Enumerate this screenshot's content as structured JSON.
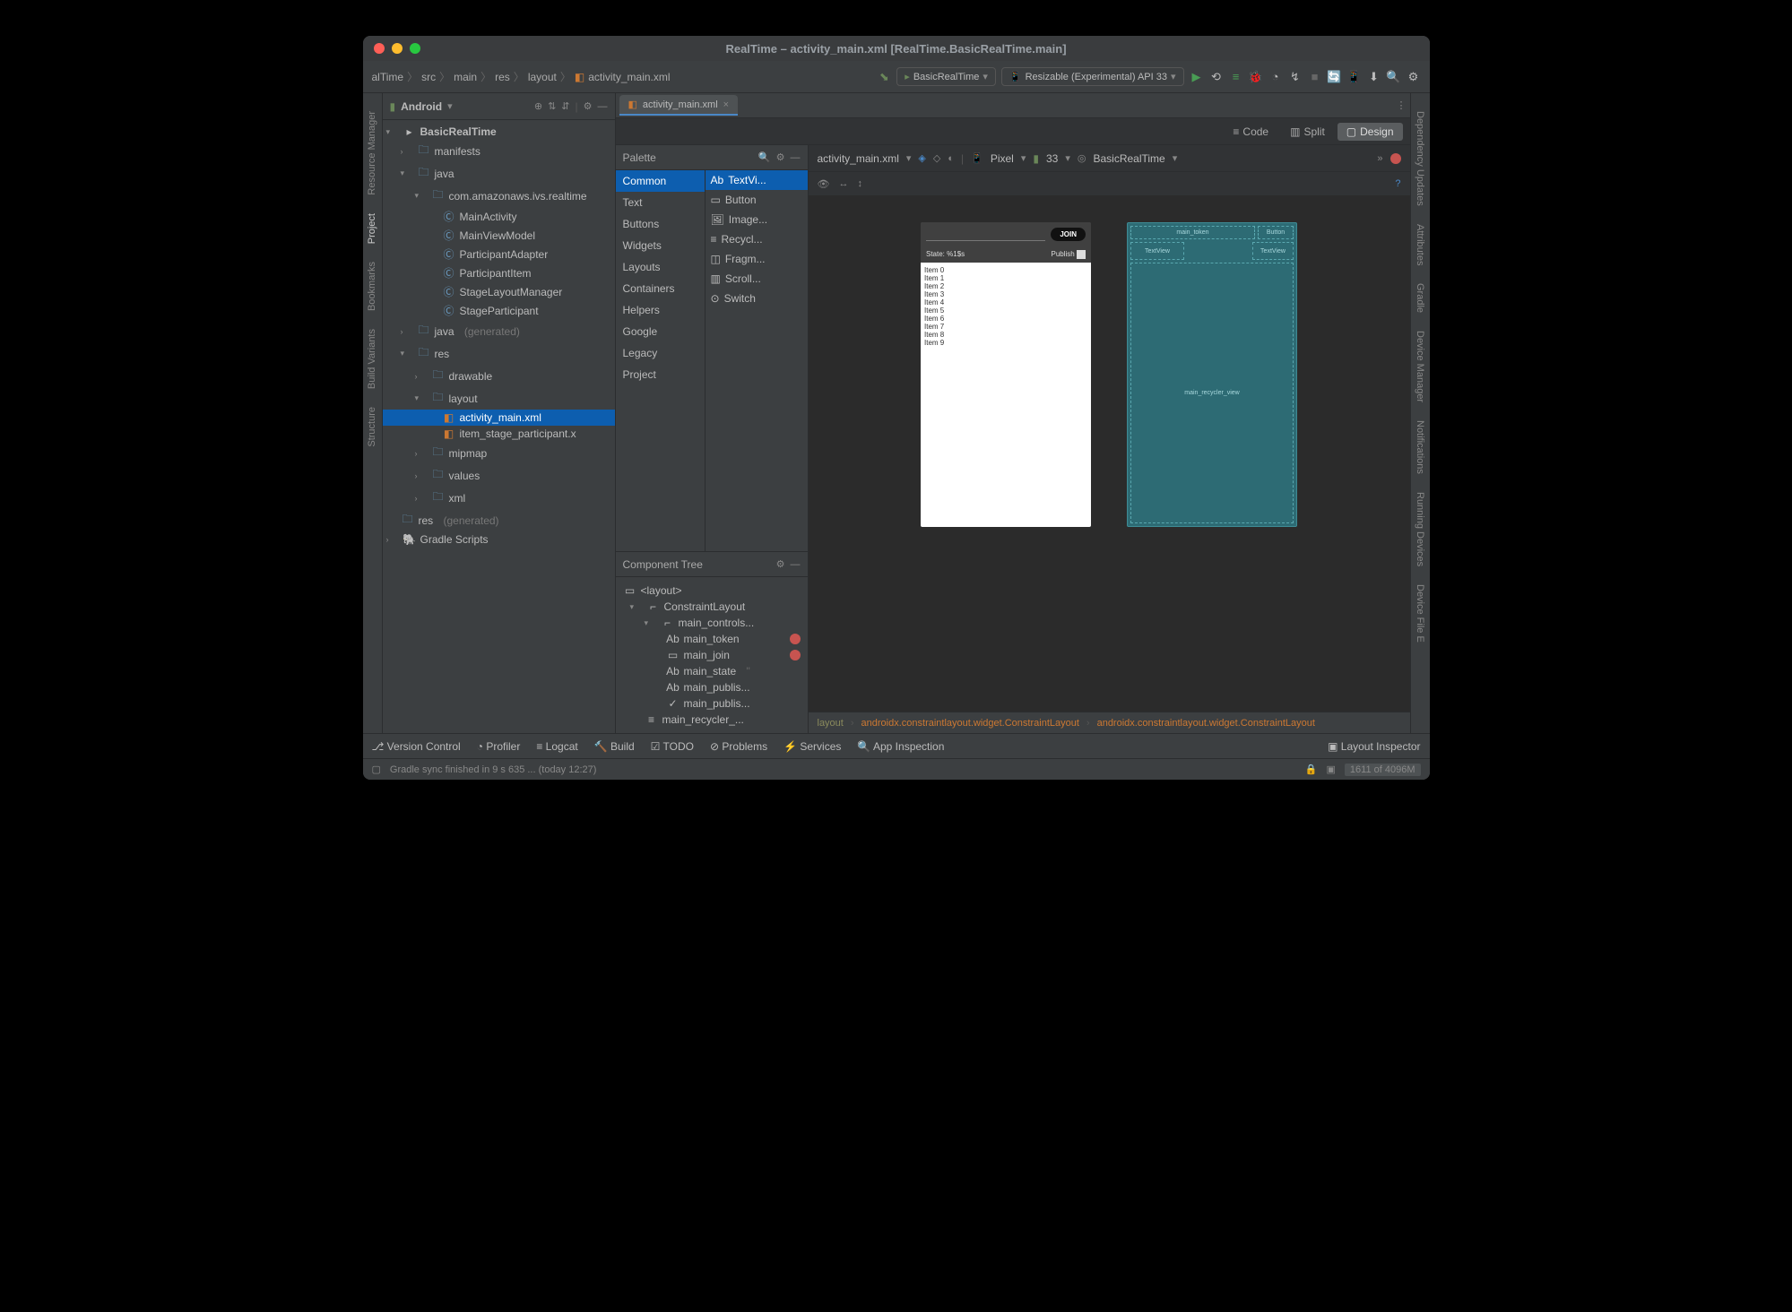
{
  "window_title": "RealTime – activity_main.xml [RealTime.BasicRealTime.main]",
  "breadcrumb": {
    "items": [
      "alTime",
      "src",
      "main",
      "res",
      "layout",
      "activity_main.xml"
    ]
  },
  "toolbar": {
    "run_config": "BasicRealTime",
    "device": "Resizable (Experimental) API 33"
  },
  "sidebar_header": "Android",
  "project_tree": {
    "root": "BasicRealTime",
    "manifests": "manifests",
    "java": "java",
    "package": "com.amazonaws.ivs.realtime",
    "classes": [
      "MainActivity",
      "MainViewModel",
      "ParticipantAdapter",
      "ParticipantItem",
      "StageLayoutManager",
      "StageParticipant"
    ],
    "java_gen": "java",
    "generated": "(generated)",
    "res": "res",
    "drawable": "drawable",
    "layout": "layout",
    "layout_files": [
      "activity_main.xml",
      "item_stage_participant.x"
    ],
    "mipmap": "mipmap",
    "values": "values",
    "xml": "xml",
    "res_gen": "res",
    "gradle": "Gradle Scripts"
  },
  "tab": {
    "name": "activity_main.xml"
  },
  "viewmodes": {
    "code": "Code",
    "split": "Split",
    "design": "Design"
  },
  "palette": {
    "title": "Palette",
    "categories": [
      "Common",
      "Text",
      "Buttons",
      "Widgets",
      "Layouts",
      "Containers",
      "Helpers",
      "Google",
      "Legacy",
      "Project"
    ],
    "items": [
      "TextVi...",
      "Button",
      "Image...",
      "Recycl...",
      "Fragm...",
      "Scroll...",
      "Switch"
    ]
  },
  "component_tree": {
    "title": "Component Tree",
    "root": "<layout>",
    "constraint": "ConstraintLayout",
    "controls": "main_controls...",
    "children": [
      "main_token",
      "main_join",
      "main_state",
      "main_publis...",
      "main_publis..."
    ],
    "recycler": "main_recycler_..."
  },
  "canvas_toolbar": {
    "file": "activity_main.xml",
    "device": "Pixel",
    "api": "33",
    "theme": "BasicRealTime"
  },
  "device_preview": {
    "placeholder": "",
    "join": "JOIN",
    "state": "State: %1$s",
    "publish": "Publish",
    "items": [
      "Item 0",
      "Item 1",
      "Item 2",
      "Item 3",
      "Item 4",
      "Item 5",
      "Item 6",
      "Item 7",
      "Item 8",
      "Item 9"
    ]
  },
  "blueprint": {
    "main_token": "main_token",
    "button": "Button",
    "textview1": "TextView",
    "textview2": "TextView",
    "recycler": "main_recycler_view"
  },
  "breadcrumb_bottom": {
    "layout": "layout",
    "c1": "androidx.constraintlayout.widget.ConstraintLayout",
    "c2": "androidx.constraintlayout.widget.ConstraintLayout"
  },
  "bottom_tools": [
    "Version Control",
    "Profiler",
    "Logcat",
    "Build",
    "TODO",
    "Problems",
    "Services",
    "App Inspection"
  ],
  "layout_inspector": "Layout Inspector",
  "status": {
    "msg": "Gradle sync finished in 9 s 635 ... (today 12:27)",
    "mem": "1611 of 4096M"
  },
  "left_gutter": [
    "Resource Manager",
    "Project",
    "Bookmarks",
    "Build Variants",
    "Structure"
  ],
  "right_gutter": [
    "Dependency Updates",
    "Attributes",
    "Gradle",
    "Device Manager",
    "Notifications",
    "Running Devices",
    "Device File E"
  ]
}
